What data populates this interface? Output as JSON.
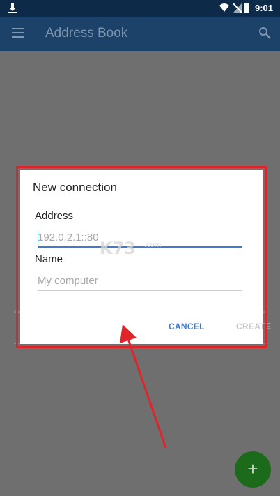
{
  "status_bar": {
    "time": "9:01"
  },
  "app_bar": {
    "title": "Address Book",
    "menu_icon": "menu-icon",
    "search_icon": "search-icon"
  },
  "dialog": {
    "title": "New connection",
    "address": {
      "label": "Address",
      "placeholder": "192.0.2.1::80"
    },
    "name": {
      "label": "Name",
      "placeholder": "My computer"
    },
    "cancel_label": "CANCEL",
    "create_label": "CREATE"
  },
  "fab": {
    "label": "+"
  },
  "colors": {
    "status_bar": "#0e2a49",
    "app_bar": "#1c426a",
    "scrim": "#6f6f6f",
    "accent": "#3c7bd0",
    "highlight_frame": "#e0242a",
    "fab": "#1b6b1b"
  }
}
